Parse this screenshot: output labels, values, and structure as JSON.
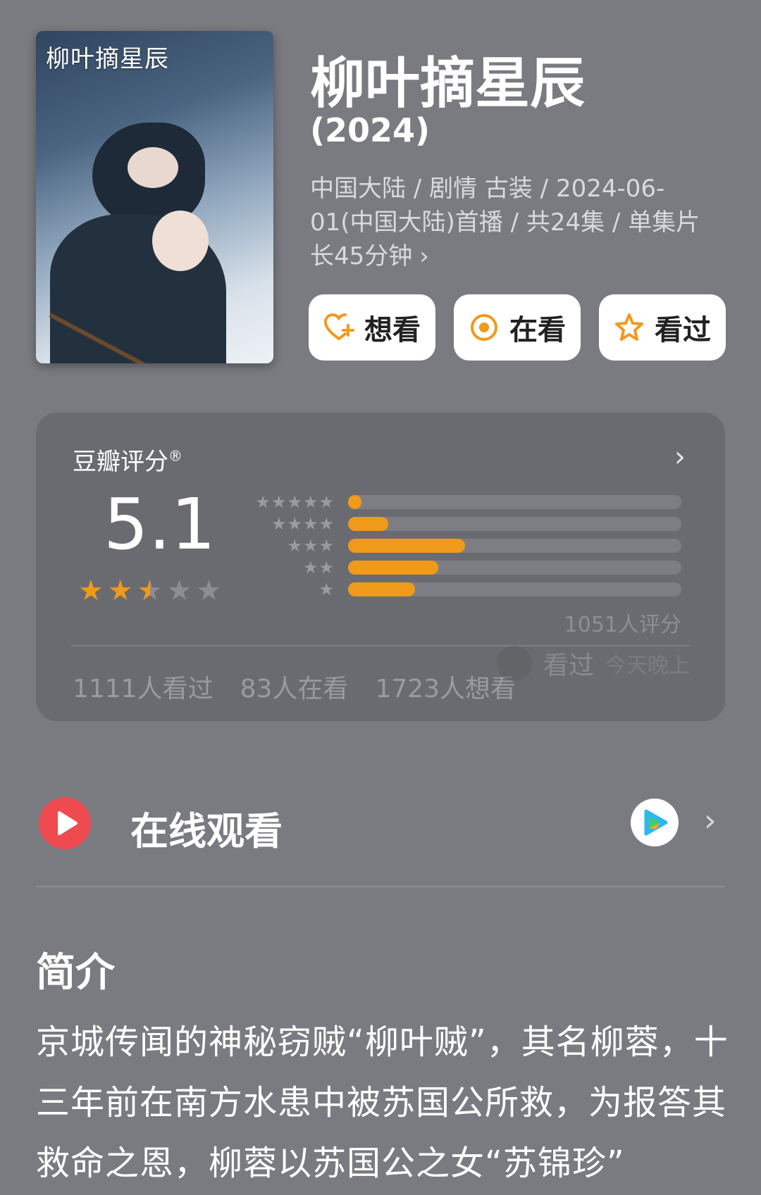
{
  "poster": {
    "alt_title": "柳叶摘星辰"
  },
  "title": "柳叶摘星辰",
  "year": "(2024)",
  "meta": "中国大陆 / 剧情 古装 / 2024-06-01(中国大陆)首播 / 共24集 / 单集片长45分钟",
  "actions": [
    {
      "label": "想看",
      "icon": "heart-plus-icon"
    },
    {
      "label": "在看",
      "icon": "target-icon"
    },
    {
      "label": "看过",
      "icon": "star-outline-icon"
    }
  ],
  "rating": {
    "title": "豆瓣评分",
    "mark": "®",
    "score": "5.1",
    "stars_filled": 2.5,
    "distribution": [
      {
        "stars": "★★★★★",
        "fraction": 0.04
      },
      {
        "stars": "★★★★",
        "fraction": 0.12
      },
      {
        "stars": "★★★",
        "fraction": 0.35
      },
      {
        "stars": "★★",
        "fraction": 0.27
      },
      {
        "stars": "★",
        "fraction": 0.2
      }
    ],
    "count": "1051人评分",
    "stats": [
      "1111人看过",
      "83人在看",
      "1723人想看"
    ],
    "ghost_action": "看过",
    "ghost_time": "今天晚上"
  },
  "watch": {
    "label": "在线观看",
    "platform_icon": "tencent-video-icon"
  },
  "intro": {
    "heading": "简介",
    "body": "京城传闻的神秘窃贼“柳叶贼”，其名柳蓉，十三年前在南方水患中被苏国公所救，为报答其救命之恩，柳蓉以苏国公之女“苏锦珍”"
  },
  "colors": {
    "accent": "#f09a1b",
    "play": "#ef4a4f",
    "background": "#7a7b80",
    "card": "#6a6b70"
  }
}
